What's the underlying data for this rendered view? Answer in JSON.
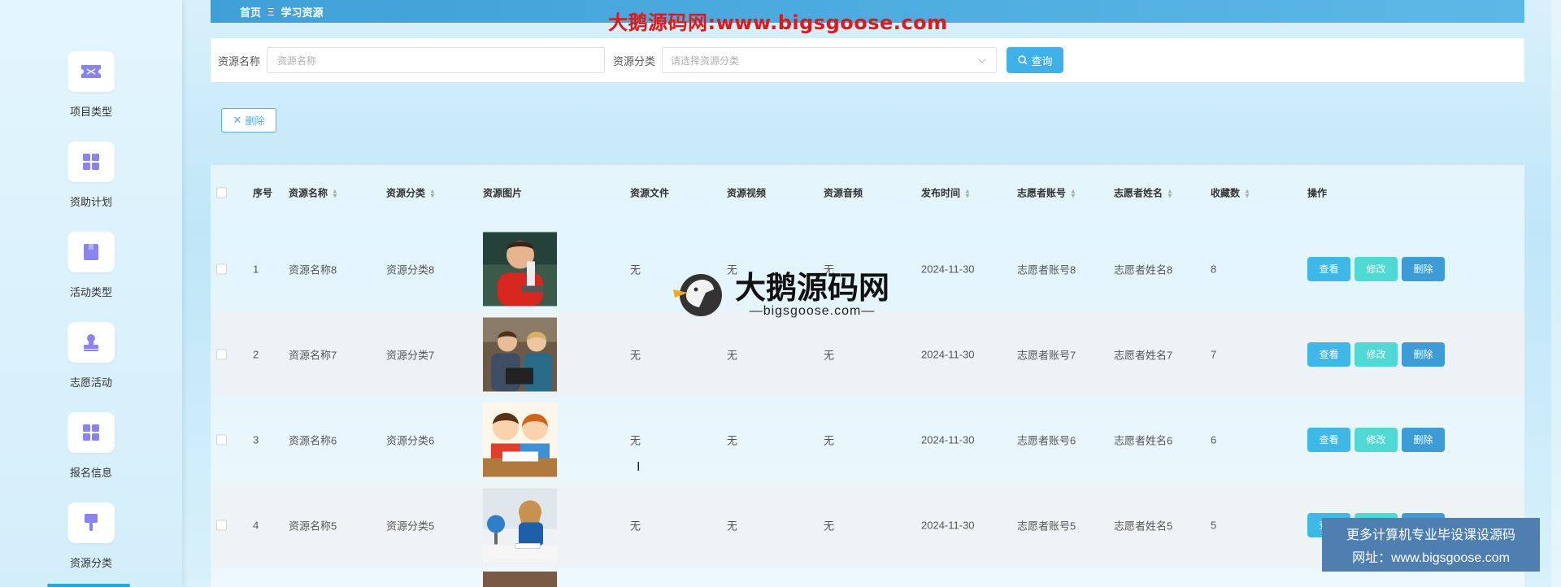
{
  "sidebar": {
    "items": [
      {
        "label": "项目类型",
        "icon": "ticket-icon"
      },
      {
        "label": "资助计划",
        "icon": "grid-icon"
      },
      {
        "label": "活动类型",
        "icon": "bookmark-icon"
      },
      {
        "label": "志愿活动",
        "icon": "stamp-icon"
      },
      {
        "label": "报名信息",
        "icon": "grid-icon"
      },
      {
        "label": "资源分类",
        "icon": "brush-icon"
      }
    ]
  },
  "breadcrumb": {
    "home": "首页",
    "separator": "Ξ",
    "current": "学习资源"
  },
  "watermark": {
    "top": "大鹅源码网:www.bigsgoose.com",
    "center_main": "大鹅源码网",
    "center_sub": "—bigsgoose.com—",
    "ad_line1": "更多计算机专业毕设课设源码",
    "ad_line2": "网址：www.bigsgoose.com"
  },
  "search": {
    "name_label": "资源名称",
    "name_placeholder": "资源名称",
    "category_label": "资源分类",
    "category_placeholder": "请选择资源分类",
    "query_button": "查询"
  },
  "actions": {
    "batch_delete": "删除"
  },
  "table": {
    "headers": [
      "序号",
      "资源名称",
      "资源分类",
      "资源图片",
      "资源文件",
      "资源视频",
      "资源音频",
      "发布时间",
      "志愿者账号",
      "志愿者姓名",
      "收藏数",
      "操作"
    ],
    "row_buttons": {
      "view": "查看",
      "edit": "修改",
      "delete": "删除"
    },
    "rows": [
      {
        "index": "1",
        "name": "资源名称8",
        "category": "资源分类8",
        "file": "无",
        "video": "无",
        "audio": "无",
        "time": "2024-11-30",
        "account": "志愿者账号8",
        "volunteer": "志愿者姓名8",
        "favorites": "8",
        "image": "boy-microscope"
      },
      {
        "index": "2",
        "name": "资源名称7",
        "category": "资源分类7",
        "file": "无",
        "video": "无",
        "audio": "无",
        "time": "2024-11-30",
        "account": "志愿者账号7",
        "volunteer": "志愿者姓名7",
        "favorites": "7",
        "image": "students-tablet"
      },
      {
        "index": "3",
        "name": "资源名称6",
        "category": "资源分类6",
        "file": "无",
        "video": "无",
        "audio": "无",
        "time": "2024-11-30",
        "account": "志愿者账号6",
        "volunteer": "志愿者姓名6",
        "favorites": "6",
        "image": "cartoon-kids-reading"
      },
      {
        "index": "4",
        "name": "资源名称5",
        "category": "资源分类5",
        "file": "无",
        "video": "无",
        "audio": "无",
        "time": "2024-11-30",
        "account": "志愿者账号5",
        "volunteer": "志愿者姓名5",
        "favorites": "5",
        "image": "girl-globe-studying"
      }
    ]
  },
  "colors": {
    "accent": "#3fb1e8",
    "edit": "#4fd8d4",
    "delete": "#3d9bd6",
    "watermark_red": "#e01818"
  }
}
